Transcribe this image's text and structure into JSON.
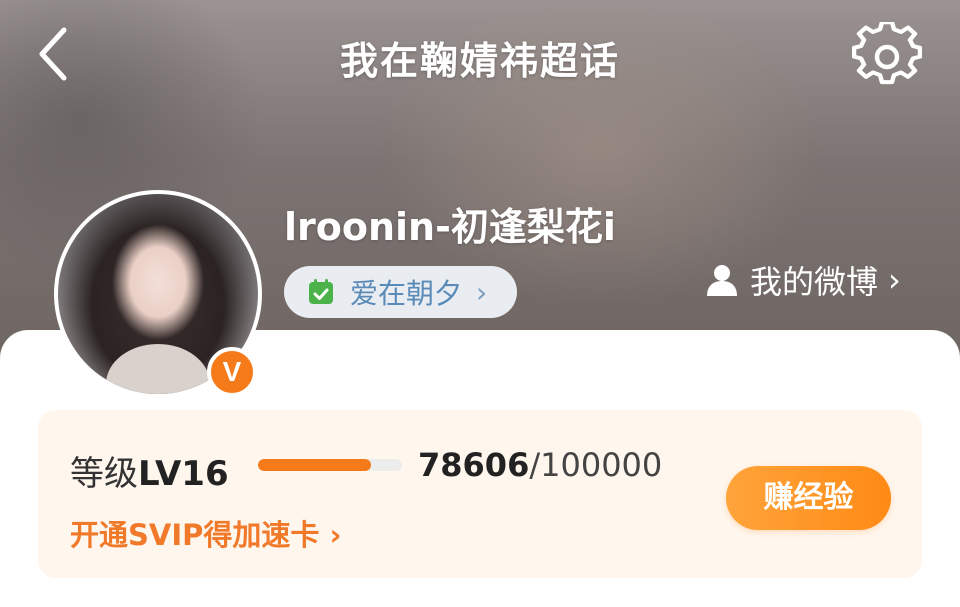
{
  "header": {
    "title": "我在鞠婧祎超话",
    "back_icon": "chevron-left-icon",
    "settings_icon": "gear-icon"
  },
  "profile": {
    "username": "lroonin-初逢梨花i",
    "verified_badge": "V",
    "fan_group": {
      "label": "爱在朝夕",
      "icon": "calendar-check-icon",
      "chevron": "›"
    },
    "my_weibo": {
      "label": "我的微博",
      "icon": "person-icon",
      "chevron": "›"
    }
  },
  "level": {
    "prefix": "等级",
    "value": "LV16",
    "exp_current": "78606",
    "exp_separator": "/",
    "exp_total": "100000",
    "progress_fraction": 0.786,
    "svip_text": "开通SVIP得加速卡 ›",
    "earn_button": "赚经验"
  },
  "colors": {
    "accent_orange": "#f47a1a",
    "fan_pill_text": "#5a8ab8",
    "level_card_bg": "#fff6ee"
  }
}
